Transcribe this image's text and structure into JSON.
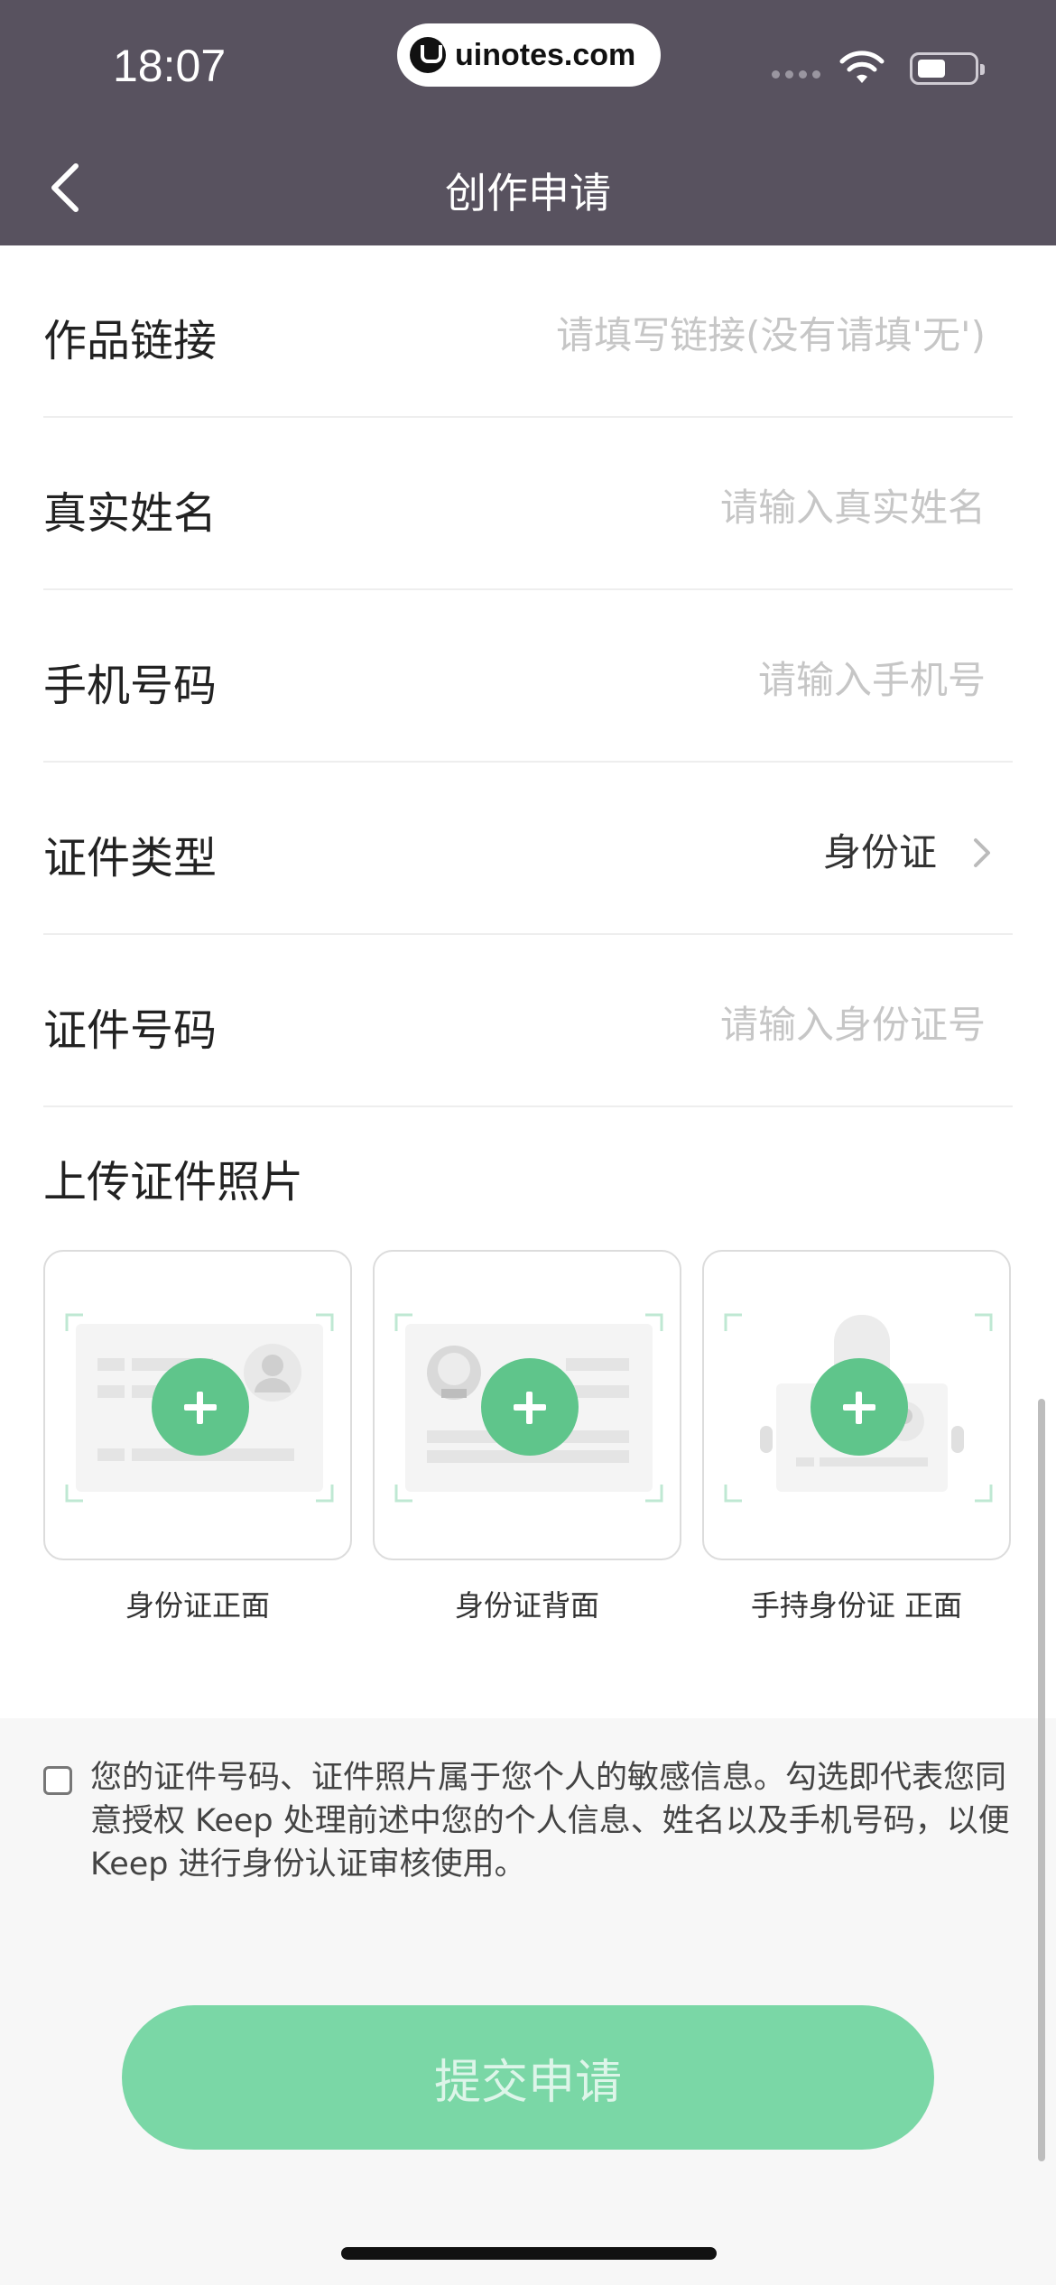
{
  "status_bar": {
    "time": "18:07",
    "url": "uinotes.com"
  },
  "header": {
    "title": "创作申请"
  },
  "form": {
    "rows": [
      {
        "label": "作品链接",
        "placeholder": "请填写链接(没有请填'无')"
      },
      {
        "label": "真实姓名",
        "placeholder": "请输入真实姓名"
      },
      {
        "label": "手机号码",
        "placeholder": "请输入手机号"
      },
      {
        "label": "证件类型",
        "value": "身份证"
      },
      {
        "label": "证件号码",
        "placeholder": "请输入身份证号"
      }
    ]
  },
  "upload": {
    "title": "上传证件照片",
    "cards": [
      {
        "label": "身份证正面"
      },
      {
        "label": "身份证背面"
      },
      {
        "label": "手持身份证 正面"
      }
    ]
  },
  "consent": {
    "text": "您的证件号码、证件照片属于您个人的敏感信息。勾选即代表您同意授权 Keep 处理前述中您的个人信息、姓名以及手机号码，以便 Keep 进行身份认证审核使用。"
  },
  "submit": {
    "label": "提交申请"
  },
  "colors": {
    "header": "#58525f",
    "accent": "#5fc58b",
    "button": "#7ad7a6"
  }
}
